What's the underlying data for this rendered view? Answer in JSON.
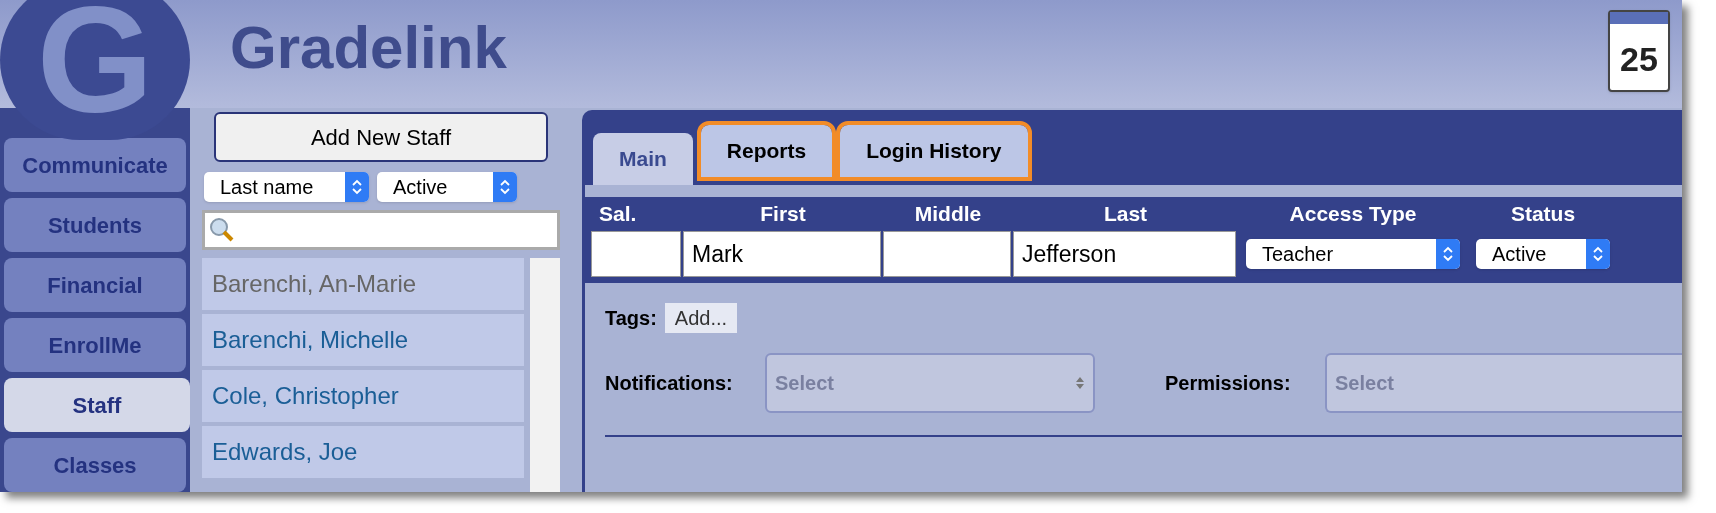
{
  "app": {
    "logo_letter": "G",
    "title": "Gradelink",
    "calendar_day": "25"
  },
  "nav": [
    {
      "label": "Communicate",
      "selected": false
    },
    {
      "label": "Students",
      "selected": false
    },
    {
      "label": "Financial",
      "selected": false
    },
    {
      "label": "EnrollMe",
      "selected": false
    },
    {
      "label": "Staff",
      "selected": true
    },
    {
      "label": "Classes",
      "selected": false
    }
  ],
  "staff_panel": {
    "add_button": "Add New Staff",
    "sort": "Last name",
    "filter": "Active",
    "items": [
      {
        "name": "Barenchi, An-Marie",
        "inactive": true
      },
      {
        "name": "Barenchi, Michelle",
        "inactive": false
      },
      {
        "name": "Cole, Christopher",
        "inactive": false
      },
      {
        "name": "Edwards, Joe",
        "inactive": false
      }
    ]
  },
  "tabs": [
    {
      "label": "Main",
      "selected": true,
      "highlighted": false
    },
    {
      "label": "Reports",
      "selected": false,
      "highlighted": true
    },
    {
      "label": "Login History",
      "selected": false,
      "highlighted": true
    }
  ],
  "fields": [
    {
      "label": "Sal.",
      "kind": "text"
    },
    {
      "label": "First",
      "kind": "text",
      "value": "Mark"
    },
    {
      "label": "Middle",
      "kind": "text"
    },
    {
      "label": "Last",
      "kind": "text",
      "value": "Jefferson"
    },
    {
      "label": "Access Type",
      "kind": "select",
      "value": "Teacher"
    },
    {
      "label": "Status",
      "kind": "select",
      "value": "Active"
    }
  ],
  "tags": {
    "label": "Tags:",
    "button": "Add..."
  },
  "notifications": {
    "label": "Notifications:",
    "placeholder": "Select"
  },
  "permissions": {
    "label": "Permissions:",
    "placeholder": "Select"
  }
}
